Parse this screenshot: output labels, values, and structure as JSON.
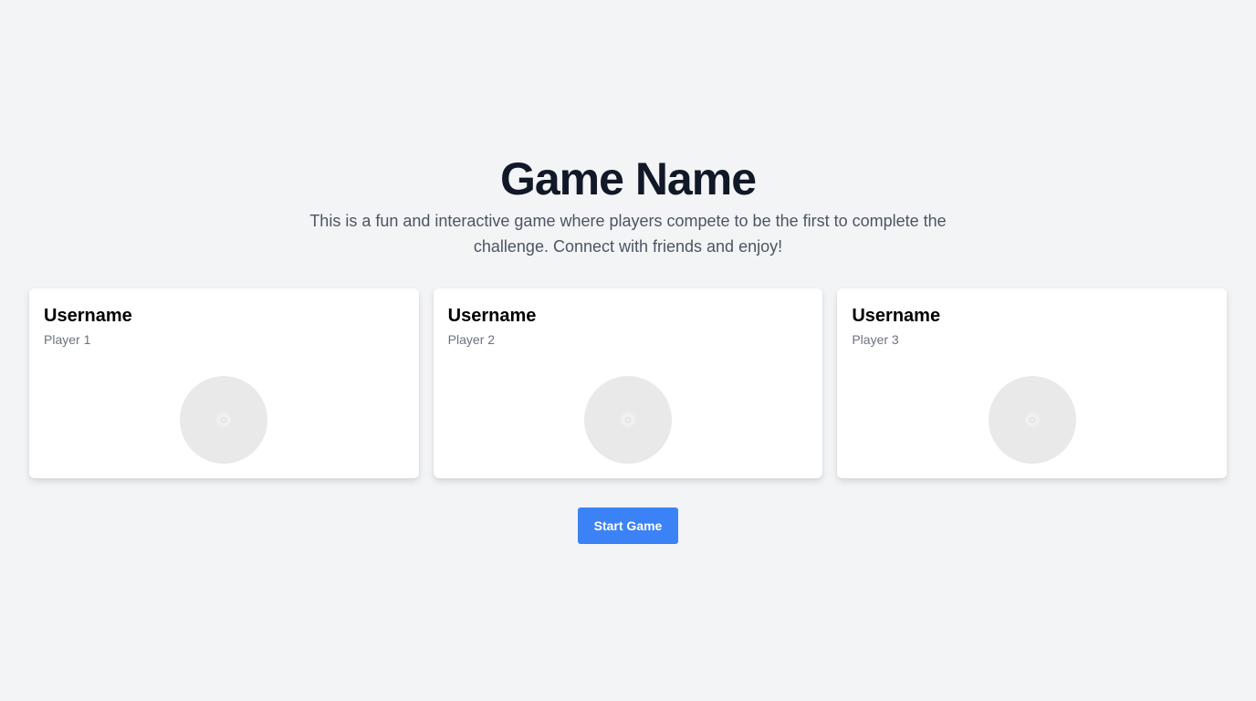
{
  "header": {
    "title": "Game Name",
    "description": "This is a fun and interactive game where players compete to be the first to complete the challenge. Connect with friends and enjoy!"
  },
  "players": [
    {
      "username": "Username",
      "label": "Player 1",
      "avatar_icon": "avatar-placeholder-icon"
    },
    {
      "username": "Username",
      "label": "Player 2",
      "avatar_icon": "avatar-placeholder-icon"
    },
    {
      "username": "Username",
      "label": "Player 3",
      "avatar_icon": "avatar-placeholder-icon"
    }
  ],
  "actions": {
    "start_label": "Start Game"
  },
  "colors": {
    "background": "#f3f4f6",
    "card": "#ffffff",
    "accent": "#3b82f6",
    "title": "#111827",
    "muted": "#6b7280"
  }
}
